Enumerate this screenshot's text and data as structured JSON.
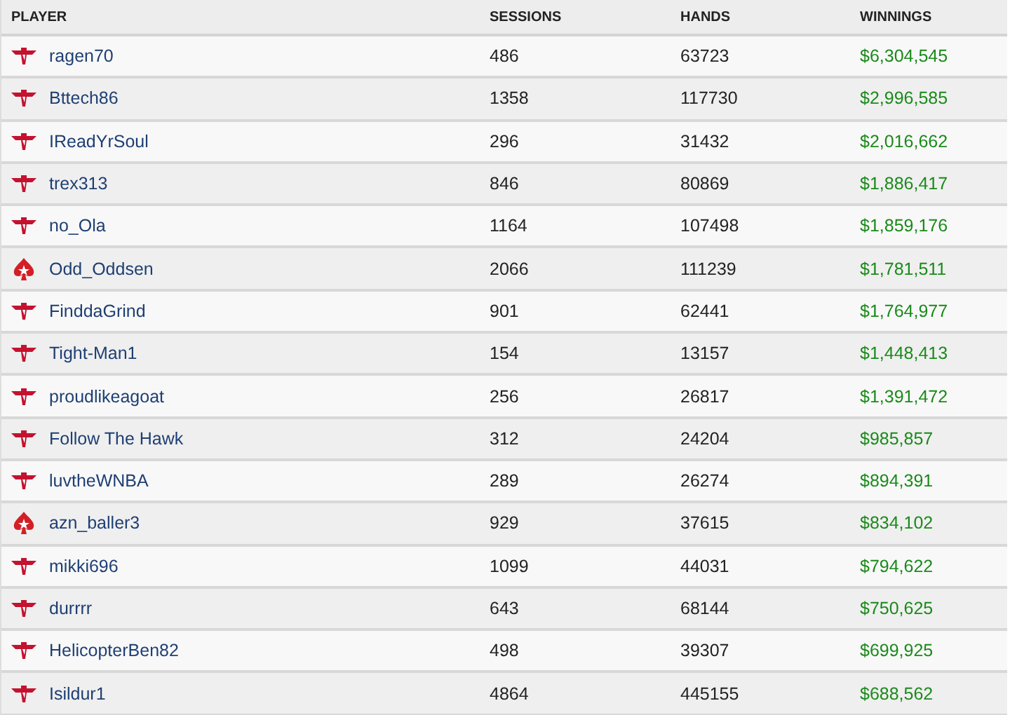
{
  "table": {
    "columns": [
      "PLAYER",
      "SESSIONS",
      "HANDS",
      "WINNINGS"
    ],
    "rows": [
      {
        "kind": "wings",
        "player": "ragen70",
        "sessions": "486",
        "hands": "63723",
        "winnings": "$6,304,545"
      },
      {
        "kind": "wings",
        "player": "Bttech86",
        "sessions": "1358",
        "hands": "117730",
        "winnings": "$2,996,585"
      },
      {
        "kind": "wings",
        "player": "IReadYrSoul",
        "sessions": "296",
        "hands": "31432",
        "winnings": "$2,016,662"
      },
      {
        "kind": "wings",
        "player": "trex313",
        "sessions": "846",
        "hands": "80869",
        "winnings": "$1,886,417"
      },
      {
        "kind": "wings",
        "player": "no_Ola",
        "sessions": "1164",
        "hands": "107498",
        "winnings": "$1,859,176"
      },
      {
        "kind": "spade",
        "player": "Odd_Oddsen",
        "sessions": "2066",
        "hands": "111239",
        "winnings": "$1,781,511"
      },
      {
        "kind": "wings",
        "player": "FinddaGrind",
        "sessions": "901",
        "hands": "62441",
        "winnings": "$1,764,977"
      },
      {
        "kind": "wings",
        "player": "Tight-Man1",
        "sessions": "154",
        "hands": "13157",
        "winnings": "$1,448,413"
      },
      {
        "kind": "wings",
        "player": "proudlikeagoat",
        "sessions": "256",
        "hands": "26817",
        "winnings": "$1,391,472"
      },
      {
        "kind": "wings",
        "player": "Follow The Hawk",
        "sessions": "312",
        "hands": "24204",
        "winnings": "$985,857"
      },
      {
        "kind": "wings",
        "player": "luvtheWNBA",
        "sessions": "289",
        "hands": "26274",
        "winnings": "$894,391"
      },
      {
        "kind": "spade",
        "player": "azn_baller3",
        "sessions": "929",
        "hands": "37615",
        "winnings": "$834,102"
      },
      {
        "kind": "wings",
        "player": "mikki696",
        "sessions": "1099",
        "hands": "44031",
        "winnings": "$794,622"
      },
      {
        "kind": "wings",
        "player": "durrrr",
        "sessions": "643",
        "hands": "68144",
        "winnings": "$750,625"
      },
      {
        "kind": "wings",
        "player": "HelicopterBen82",
        "sessions": "498",
        "hands": "39307",
        "winnings": "$699,925"
      },
      {
        "kind": "wings",
        "player": "Isildur1",
        "sessions": "4864",
        "hands": "445155",
        "winnings": "$688,562"
      }
    ]
  }
}
